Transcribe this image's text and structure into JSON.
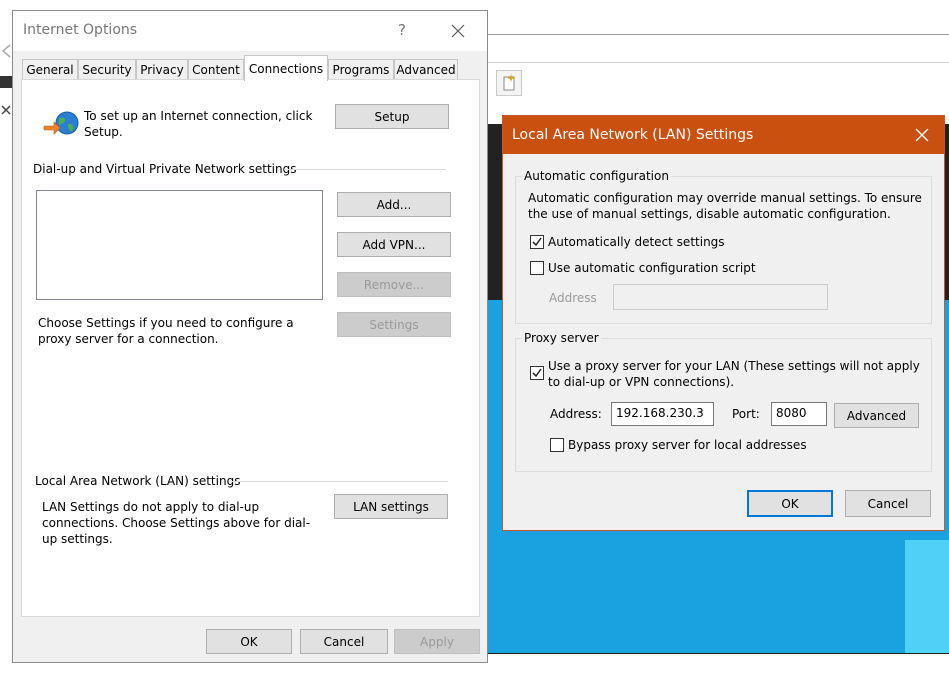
{
  "internet_options": {
    "title": "Internet Options",
    "help_glyph": "?",
    "tabs": [
      {
        "label": "General"
      },
      {
        "label": "Security"
      },
      {
        "label": "Privacy"
      },
      {
        "label": "Content"
      },
      {
        "label": "Connections"
      },
      {
        "label": "Programs"
      },
      {
        "label": "Advanced"
      }
    ],
    "active_tab": "Connections",
    "setup_text": "To set up an Internet connection, click Setup.",
    "setup_button": "Setup",
    "dialup_header": "Dial-up and Virtual Private Network settings",
    "add_button": "Add...",
    "add_vpn_button": "Add VPN...",
    "remove_button": "Remove...",
    "settings_button": "Settings",
    "choose_settings_text": "Choose Settings if you need to configure a proxy server for a connection.",
    "lan_header": "Local Area Network (LAN) settings",
    "lan_text": "LAN Settings do not apply to dial-up connections. Choose Settings above for dial-up settings.",
    "lan_settings_button": "LAN settings",
    "ok_button": "OK",
    "cancel_button": "Cancel",
    "apply_button": "Apply"
  },
  "lan_dialog": {
    "title": "Local Area Network (LAN) Settings",
    "auto_config_label": "Automatic configuration",
    "auto_config_text": "Automatic configuration may override manual settings.  To ensure the use of manual settings, disable automatic configuration.",
    "auto_detect_label": "Automatically detect settings",
    "auto_detect_checked": true,
    "auto_script_label": "Use automatic configuration script",
    "auto_script_checked": false,
    "script_address_label": "Address",
    "script_address_value": "",
    "proxy_label": "Proxy server",
    "use_proxy_label": "Use a proxy server for your LAN (These settings will not apply to dial-up or VPN connections).",
    "use_proxy_checked": true,
    "address_label": "Address:",
    "address_value": "192.168.230.3",
    "port_label": "Port:",
    "port_value": "8080",
    "advanced_button": "Advanced",
    "bypass_label": "Bypass proxy server for local addresses",
    "bypass_checked": false,
    "ok_button": "OK",
    "cancel_button": "Cancel"
  },
  "colors": {
    "lan_titlebar": "#ca5010",
    "default_button_border": "#0078d7",
    "background_blue": "#1aa1e0"
  }
}
